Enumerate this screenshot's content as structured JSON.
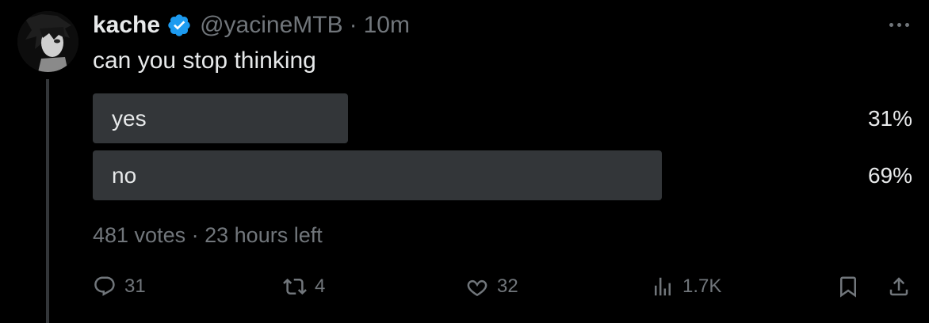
{
  "tweet": {
    "display_name": "kache",
    "handle": "@yacineMTB",
    "separator": "·",
    "time": "10m",
    "text": "can you stop thinking",
    "verified_color": "#1d9bf0"
  },
  "poll": {
    "options": [
      {
        "label": "yes",
        "percent": "31%",
        "share": 0.31
      },
      {
        "label": "no",
        "percent": "69%",
        "share": 0.69
      }
    ],
    "votes": "481 votes",
    "separator": "·",
    "time_left": "23 hours left"
  },
  "actions": {
    "reply": {
      "icon": "reply-icon",
      "count": "31"
    },
    "retweet": {
      "icon": "retweet-icon",
      "count": "4"
    },
    "like": {
      "icon": "heart-icon",
      "count": "32"
    },
    "views": {
      "icon": "views-icon",
      "count": "1.7K"
    },
    "bookmark": {
      "icon": "bookmark-icon"
    },
    "share": {
      "icon": "share-icon"
    }
  },
  "colors": {
    "background": "#000000",
    "text": "#e7e9ea",
    "muted": "#71767b",
    "poll_bar": "#333639"
  }
}
